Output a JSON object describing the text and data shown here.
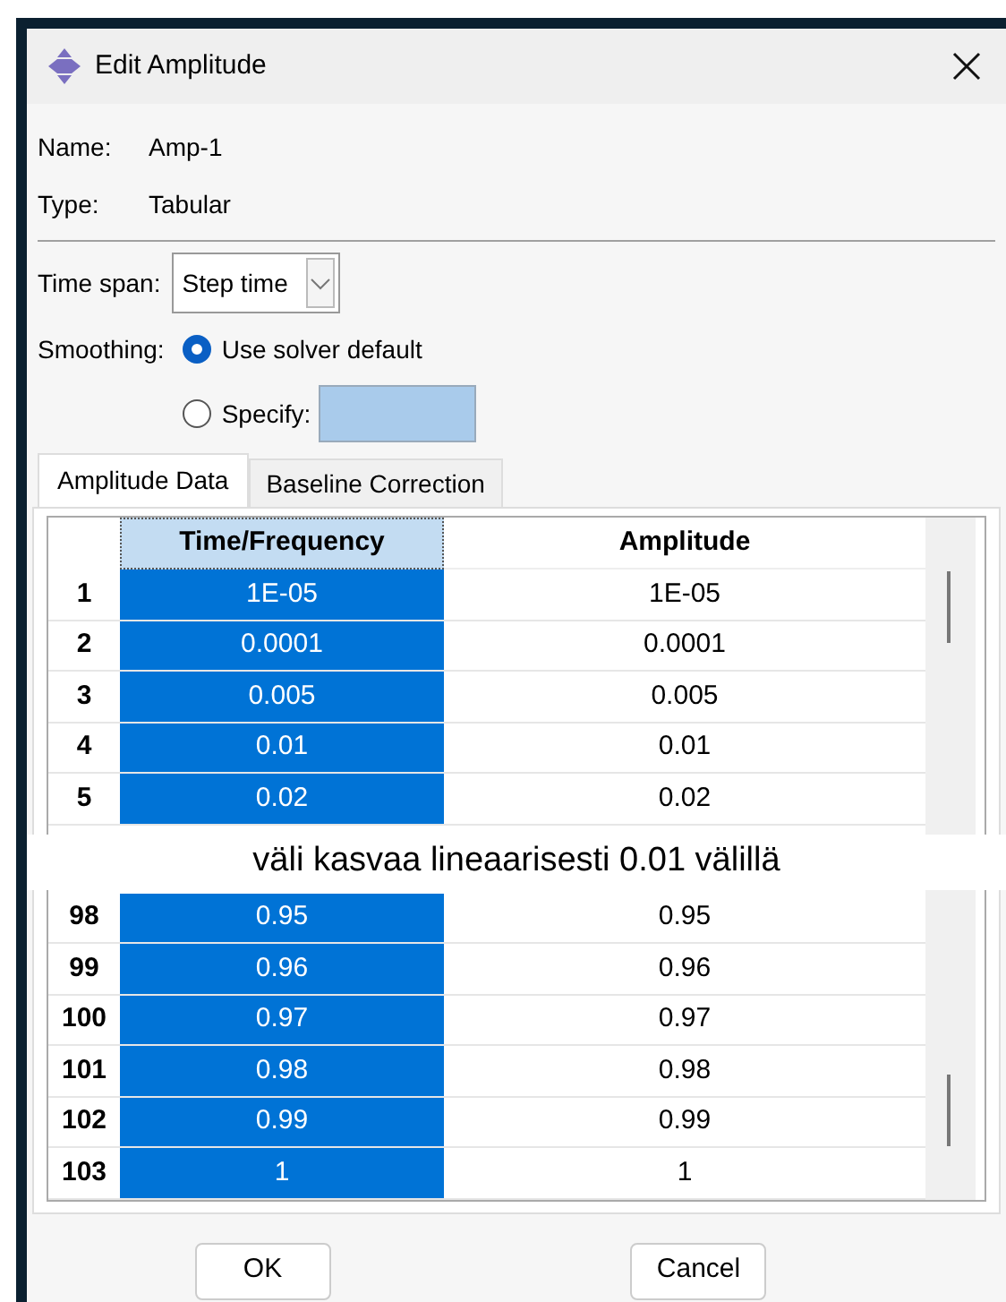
{
  "window": {
    "title": "Edit Amplitude"
  },
  "fields": [
    {
      "label": "Name:",
      "value": "Amp-1"
    },
    {
      "label": "Type:",
      "value": "Tabular"
    }
  ],
  "time_span": {
    "label": "Time span:",
    "value": "Step time"
  },
  "smoothing": {
    "label": "Smoothing:",
    "options": [
      {
        "label": "Use solver default",
        "selected": true
      },
      {
        "label": "Specify:",
        "selected": false
      }
    ]
  },
  "tabs": [
    {
      "label": "Amplitude Data",
      "selected": true
    },
    {
      "label": "Baseline Correction",
      "selected": false
    }
  ],
  "table": {
    "columns": [
      "Time/Frequency",
      "Amplitude"
    ],
    "rows_top": [
      {
        "index": "1",
        "cells": [
          {
            "text": "1E-05",
            "selected": true
          },
          {
            "text": "1E-05",
            "selected": false
          }
        ]
      },
      {
        "index": "2",
        "cells": [
          {
            "text": "0.0001",
            "selected": true
          },
          {
            "text": "0.0001",
            "selected": false
          }
        ]
      },
      {
        "index": "3",
        "cells": [
          {
            "text": "0.005",
            "selected": true
          },
          {
            "text": "0.005",
            "selected": false
          }
        ]
      },
      {
        "index": "4",
        "cells": [
          {
            "text": "0.01",
            "selected": true
          },
          {
            "text": "0.01",
            "selected": false
          }
        ]
      },
      {
        "index": "5",
        "cells": [
          {
            "text": "0.02",
            "selected": true
          },
          {
            "text": "0.02",
            "selected": false
          }
        ]
      }
    ],
    "note": "väli kasvaa lineaarisesti 0.01 välillä",
    "rows_bottom": [
      {
        "index": "98",
        "cells": [
          {
            "text": "0.95",
            "selected": true
          },
          {
            "text": "0.95",
            "selected": false
          }
        ]
      },
      {
        "index": "99",
        "cells": [
          {
            "text": "0.96",
            "selected": true
          },
          {
            "text": "0.96",
            "selected": false
          }
        ]
      },
      {
        "index": "100",
        "cells": [
          {
            "text": "0.97",
            "selected": true
          },
          {
            "text": "0.97",
            "selected": false
          }
        ]
      },
      {
        "index": "101",
        "cells": [
          {
            "text": "0.98",
            "selected": true
          },
          {
            "text": "0.98",
            "selected": false
          }
        ]
      },
      {
        "index": "102",
        "cells": [
          {
            "text": "0.99",
            "selected": true
          },
          {
            "text": "0.99",
            "selected": false
          }
        ]
      },
      {
        "index": "103",
        "cells": [
          {
            "text": "1",
            "selected": true
          },
          {
            "text": "1",
            "selected": false
          }
        ]
      }
    ]
  },
  "buttons": [
    "OK",
    "Cancel"
  ]
}
